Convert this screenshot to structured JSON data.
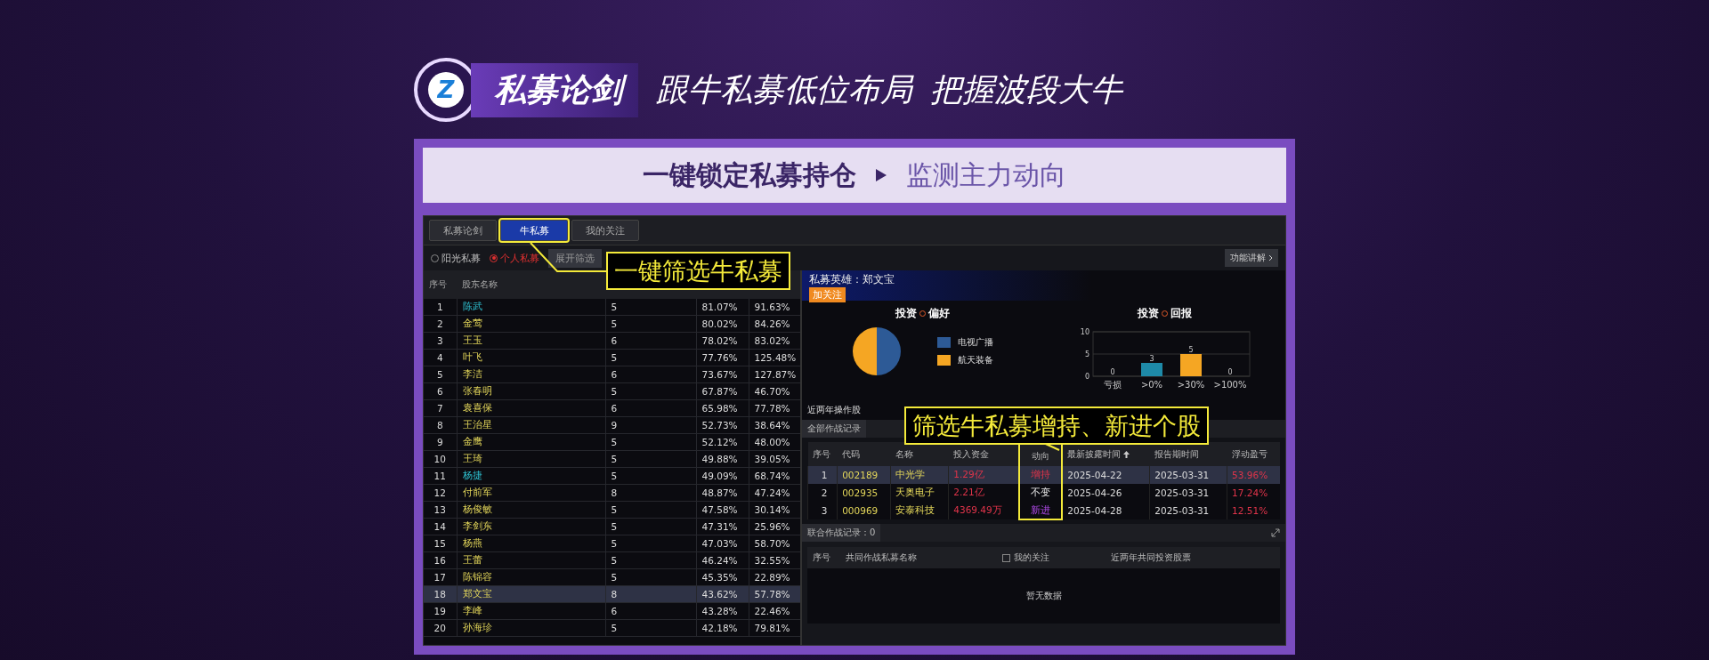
{
  "header": {
    "logo_letter": "Z",
    "badge": "私募论剑",
    "slogans": [
      "跟牛私募低位布局",
      "把握波段大牛"
    ]
  },
  "banner": {
    "main": "一键锁定私募持仓",
    "sub": "监测主力动向"
  },
  "tabs": [
    {
      "label": "私募论剑",
      "selected": false
    },
    {
      "label": "牛私募",
      "selected": true
    },
    {
      "label": "我的关注",
      "selected": false
    }
  ],
  "filters": [
    {
      "label": "阳光私募",
      "selected": false
    },
    {
      "label": "个人私募",
      "selected": true
    }
  ],
  "filter_button": "展开筛选",
  "help_button": "功能讲解",
  "left_table": {
    "columns": [
      "序号",
      "股东名称"
    ],
    "rows": [
      {
        "cells": [
          "1",
          "陈武",
          "5",
          "81.07%",
          "91.63%"
        ],
        "highlighted": true,
        "selected": false
      },
      {
        "cells": [
          "2",
          "金莺",
          "5",
          "80.02%",
          "84.26%"
        ],
        "highlighted": false,
        "selected": false
      },
      {
        "cells": [
          "3",
          "王玉",
          "6",
          "78.02%",
          "83.02%"
        ],
        "highlighted": false,
        "selected": false
      },
      {
        "cells": [
          "4",
          "叶飞",
          "5",
          "77.76%",
          "125.48%"
        ],
        "highlighted": false,
        "selected": false
      },
      {
        "cells": [
          "5",
          "李洁",
          "6",
          "73.67%",
          "127.87%"
        ],
        "highlighted": false,
        "selected": false
      },
      {
        "cells": [
          "6",
          "张春明",
          "5",
          "67.87%",
          "46.70%"
        ],
        "highlighted": false,
        "selected": false
      },
      {
        "cells": [
          "7",
          "袁喜保",
          "6",
          "65.98%",
          "77.78%"
        ],
        "highlighted": false,
        "selected": false
      },
      {
        "cells": [
          "8",
          "王治星",
          "9",
          "52.73%",
          "38.64%"
        ],
        "highlighted": false,
        "selected": false
      },
      {
        "cells": [
          "9",
          "金鹰",
          "5",
          "52.12%",
          "48.00%"
        ],
        "highlighted": false,
        "selected": false
      },
      {
        "cells": [
          "10",
          "王琦",
          "5",
          "49.88%",
          "39.05%"
        ],
        "highlighted": false,
        "selected": false
      },
      {
        "cells": [
          "11",
          "杨捷",
          "5",
          "49.09%",
          "68.74%"
        ],
        "highlighted": true,
        "selected": false
      },
      {
        "cells": [
          "12",
          "付前军",
          "8",
          "48.87%",
          "47.24%"
        ],
        "highlighted": false,
        "selected": false
      },
      {
        "cells": [
          "13",
          "杨俊敏",
          "5",
          "47.58%",
          "30.14%"
        ],
        "highlighted": false,
        "selected": false
      },
      {
        "cells": [
          "14",
          "李剑东",
          "5",
          "47.31%",
          "25.96%"
        ],
        "highlighted": false,
        "selected": false
      },
      {
        "cells": [
          "15",
          "杨燕",
          "5",
          "47.03%",
          "58.70%"
        ],
        "highlighted": false,
        "selected": false
      },
      {
        "cells": [
          "16",
          "王蕾",
          "5",
          "46.24%",
          "32.55%"
        ],
        "highlighted": false,
        "selected": false
      },
      {
        "cells": [
          "17",
          "陈锦容",
          "5",
          "45.35%",
          "22.89%"
        ],
        "highlighted": false,
        "selected": false
      },
      {
        "cells": [
          "18",
          "郑文宝",
          "8",
          "43.62%",
          "57.78%"
        ],
        "highlighted": false,
        "selected": true
      },
      {
        "cells": [
          "19",
          "李峰",
          "6",
          "43.28%",
          "22.46%"
        ],
        "highlighted": false,
        "selected": false
      },
      {
        "cells": [
          "20",
          "孙海珍",
          "5",
          "42.18%",
          "79.81%"
        ],
        "highlighted": false,
        "selected": false
      }
    ]
  },
  "hero": {
    "title": "私募英雄：郑文宝",
    "follow_button": "加关注"
  },
  "preference": {
    "title": [
      "投资",
      "偏好"
    ],
    "chart_data": {
      "type": "pie",
      "categories": [
        "电视广播",
        "航天装备"
      ],
      "values": [
        50,
        50
      ],
      "colors": [
        "#2d5a96",
        "#f5a623"
      ]
    }
  },
  "returns": {
    "title": [
      "投资",
      "回报"
    ],
    "chart_data": {
      "type": "bar",
      "categories": [
        "亏损",
        ">0%",
        ">30%",
        ">100%"
      ],
      "values": [
        0,
        3,
        5,
        0
      ],
      "colors": [
        "#f5a623",
        "#1e8aa8",
        "#f5a623",
        "#f5a623"
      ],
      "ylim": [
        0,
        10
      ],
      "yticks": [
        0,
        5,
        10
      ],
      "data_labels": true
    }
  },
  "stats_label": "近两年操作股",
  "records": {
    "tab": "全部作战记录",
    "columns": [
      "序号",
      "代码",
      "名称",
      "投入资金",
      "动向",
      "最新披露时间",
      "报告期时间",
      "浮动盈亏"
    ],
    "rows": [
      {
        "seq": "1",
        "code": "002189",
        "name": "中光学",
        "amount": "1.29亿",
        "direction": "增持",
        "kind": "increase",
        "disclosed": "2025-04-22",
        "period": "2025-03-31",
        "pnl": "53.96%",
        "selected": true
      },
      {
        "seq": "2",
        "code": "002935",
        "name": "天奥电子",
        "amount": "2.21亿",
        "direction": "不变",
        "kind": "unchanged",
        "disclosed": "2025-04-26",
        "period": "2025-03-31",
        "pnl": "17.24%",
        "selected": false
      },
      {
        "seq": "3",
        "code": "000969",
        "name": "安泰科技",
        "amount": "4369.49万",
        "direction": "新进",
        "kind": "new",
        "disclosed": "2025-04-28",
        "period": "2025-03-31",
        "pnl": "12.51%",
        "selected": false
      }
    ]
  },
  "joint": {
    "tab": "联合作战记录：0",
    "columns": [
      "序号",
      "共同作战私募名称"
    ],
    "follow_label": "我的关注",
    "follow_checked": false,
    "last_column": "近两年共同投资股票",
    "empty": "暂无数据"
  },
  "callouts": [
    "一键筛选牛私募",
    "筛选牛私募增持、新进个股"
  ]
}
